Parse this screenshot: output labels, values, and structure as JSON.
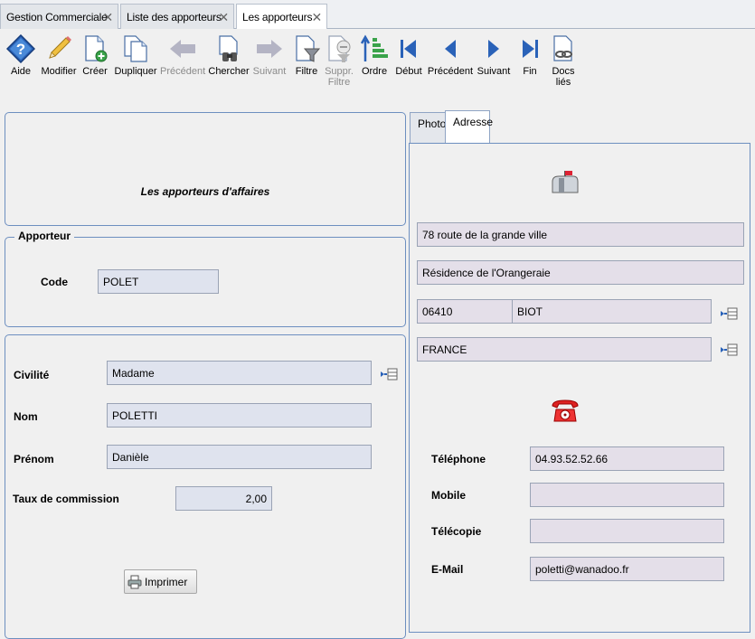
{
  "tabs": [
    {
      "label": "Gestion Commerciale"
    },
    {
      "label": "Liste des apporteurs"
    },
    {
      "label": "Les apporteurs"
    }
  ],
  "toolbar": {
    "aide": "Aide",
    "modifier": "Modifier",
    "creer": "Créer",
    "dupliquer": "Dupliquer",
    "precedent_disabled": "Précédent",
    "chercher": "Chercher",
    "suivant_disabled": "Suivant",
    "filtre": "Filtre",
    "suppr_filtre_1": "Suppr.",
    "suppr_filtre_2": "Filtre",
    "ordre": "Ordre",
    "debut": "Début",
    "precedent": "Précédent",
    "suivant": "Suivant",
    "fin": "Fin",
    "docs_1": "Docs",
    "docs_2": "liés"
  },
  "header_panel": {
    "title": "Les apporteurs d'affaires"
  },
  "apporteur": {
    "legend": "Apporteur",
    "code_label": "Code",
    "code_value": "POLET"
  },
  "person": {
    "civilite_label": "Civilité",
    "civilite_value": "Madame",
    "nom_label": "Nom",
    "nom_value": "POLETTI",
    "prenom_label": "Prénom",
    "prenom_value": "Danièle",
    "taux_label": "Taux de commission",
    "taux_value": "2,00",
    "print_button": "Imprimer"
  },
  "right_tabs": {
    "photo": "Photo",
    "adresse": "Adresse"
  },
  "adresse": {
    "ligne1": "78 route de la grande ville",
    "ligne2": "Résidence de l'Orangeraie",
    "code_postal": "06410",
    "ville": "BIOT",
    "pays": "FRANCE",
    "telephone_label": "Téléphone",
    "telephone_value": "04.93.52.52.66",
    "mobile_label": "Mobile",
    "mobile_value": "",
    "telecopie_label": "Télécopie",
    "telecopie_value": "",
    "email_label": "E-Mail",
    "email_value": "poletti@wanadoo.fr"
  },
  "icons": [
    "help-icon",
    "pencil-icon",
    "new-document-icon",
    "duplicate-icon",
    "arrow-left-icon",
    "binoculars-icon",
    "arrow-right-icon",
    "filter-icon",
    "remove-filter-icon",
    "sort-order-icon",
    "first-record-icon",
    "previous-record-icon",
    "next-record-icon",
    "last-record-icon",
    "linked-docs-icon",
    "mailbox-icon",
    "telephone-icon",
    "list-picker-icon",
    "printer-icon"
  ]
}
